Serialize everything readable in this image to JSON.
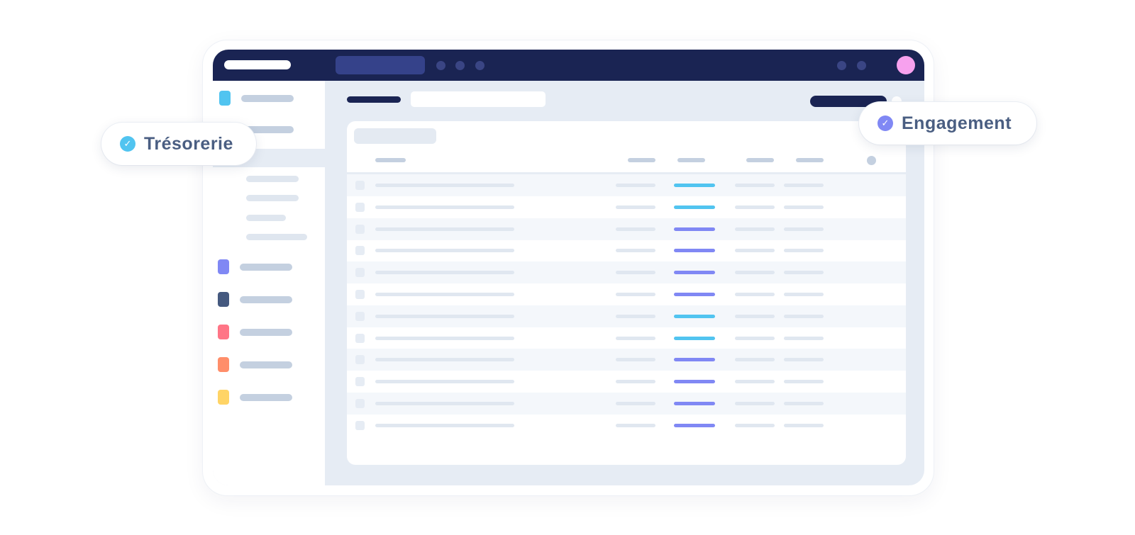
{
  "badges": {
    "tresorerie": {
      "label": "Trésorerie",
      "icon": "check-circle-icon",
      "color": "#51c4f0"
    },
    "engagement": {
      "label": "Engagement",
      "icon": "check-circle-icon",
      "color": "#8088f4"
    }
  },
  "check_glyph": "✓",
  "colors": {
    "topbar": "#1a2453",
    "avatar": "#f7a1ee",
    "accent_cyan": "#51c4f0",
    "accent_purple": "#8088f4",
    "sidebar_squares": [
      "#51c4f0",
      "#8088f4",
      "#45597f",
      "#ff7586",
      "#ff8e6a",
      "#ffd466"
    ]
  },
  "table": {
    "row_tags": [
      "cyan",
      "cyan",
      "purple",
      "purple",
      "purple",
      "purple",
      "cyan",
      "cyan",
      "purple",
      "purple",
      "purple",
      "purple"
    ]
  }
}
